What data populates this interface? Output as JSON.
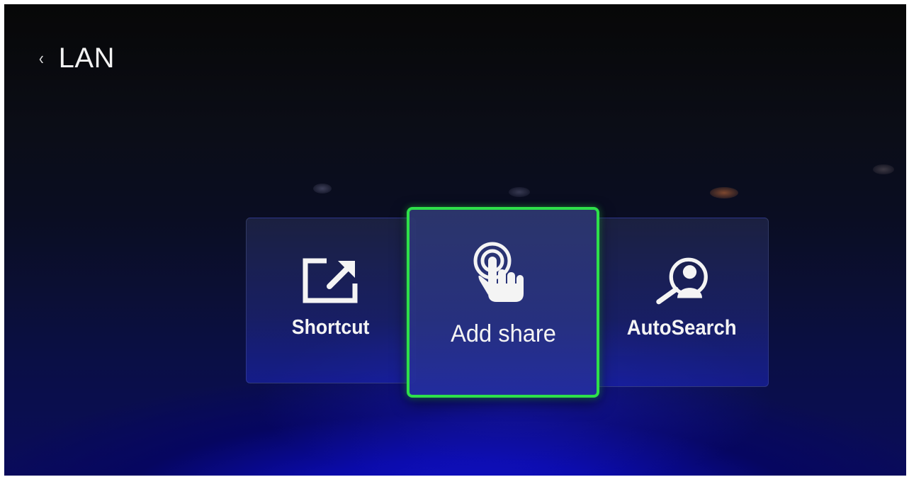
{
  "header": {
    "back_icon": "chevron-left-icon",
    "title": "LAN"
  },
  "tiles": [
    {
      "label": "Shortcut",
      "icon": "external-link-icon",
      "selected": false
    },
    {
      "label": "Add share",
      "icon": "touch-hand-icon",
      "selected": true
    },
    {
      "label": "AutoSearch",
      "icon": "user-search-icon",
      "selected": false
    }
  ],
  "colors": {
    "focus_border": "#2ee04a",
    "background_top": "#070707",
    "background_glow": "#1414d8",
    "text": "#f4f4f4"
  }
}
